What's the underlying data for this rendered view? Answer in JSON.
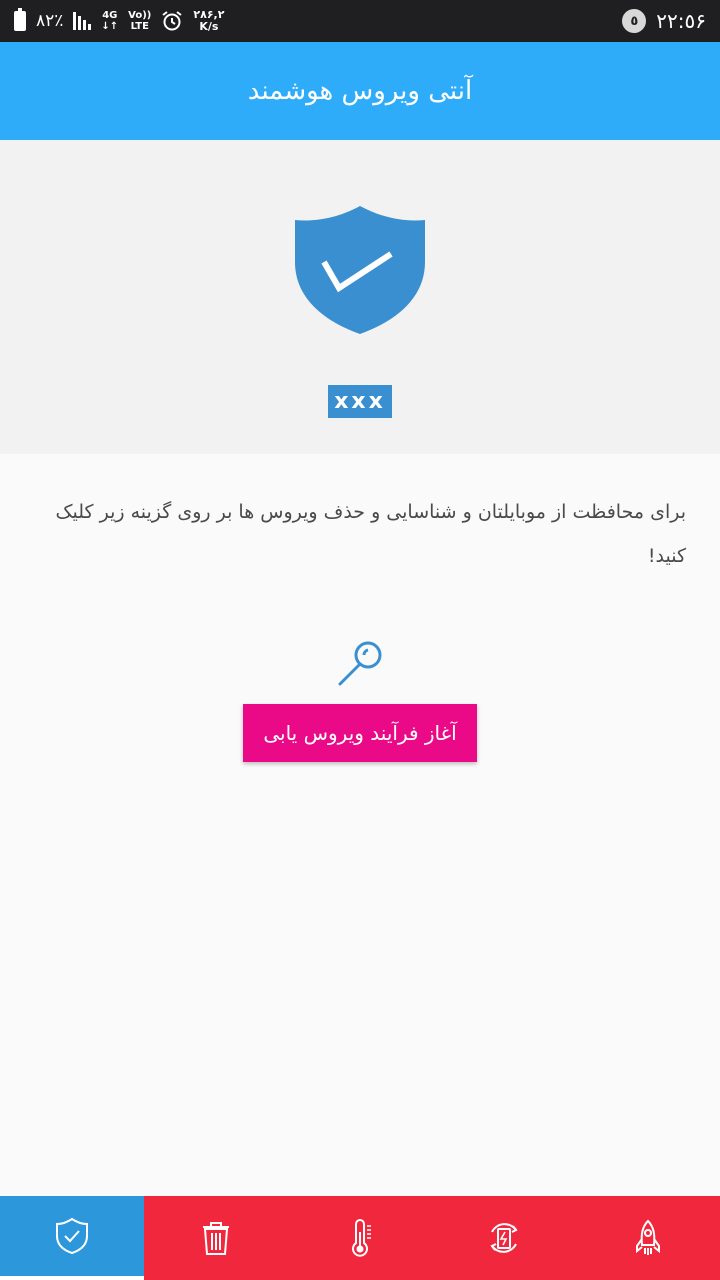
{
  "status_bar": {
    "battery_text": "٨٢٪",
    "network_top": "4G",
    "volte_top": "Vo))",
    "volte_bottom": "LTE",
    "speed_value": "٢٨۶,٢",
    "speed_unit": "K/s",
    "time": "٢٢:٥۶",
    "notification_count": "٥"
  },
  "app_bar": {
    "title": "آنتی ویروس هوشمند"
  },
  "hero": {
    "badge_text": "xxx"
  },
  "main": {
    "description": "برای محافظت از موبایلتان و شناسایی و حذف ویروس ها بر روی گزینه زیر کلیک کنید!",
    "scan_button_label": "آغاز فرآیند ویروس یابی"
  },
  "bottom_nav": {
    "items": [
      {
        "icon": "shield-check-icon",
        "active": true
      },
      {
        "icon": "trash-icon",
        "active": false
      },
      {
        "icon": "thermometer-icon",
        "active": false
      },
      {
        "icon": "battery-refresh-icon",
        "active": false
      },
      {
        "icon": "rocket-icon",
        "active": false
      }
    ]
  },
  "colors": {
    "app_bar": "#2eacfa",
    "shield": "#3a8fd0",
    "scan_button": "#ea0a87",
    "bottom_nav": "#f1273d",
    "bottom_nav_active": "#2d97dc"
  }
}
